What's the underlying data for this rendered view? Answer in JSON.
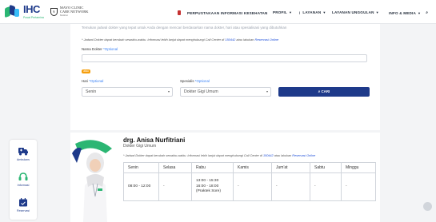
{
  "header": {
    "logo_main": "IHC",
    "logo_sub": "Pusat Pertamina",
    "mayo_l1": "MAYO CLINIC",
    "mayo_l2": "CARE NETWORK",
    "mayo_l3": "Member",
    "nav": [
      {
        "label": "PERPUSTAKAAN INFORMASI KESEHATAN"
      },
      {
        "label": "PROFIL"
      },
      {
        "label": "LAYANAN"
      },
      {
        "label": "LAYANAN UNGGULAN"
      },
      {
        "label": "INFO & MEDIA"
      }
    ]
  },
  "form": {
    "top_notice": "Temukan jadwal dokter yang tepat untuk Anda dengan mencari berdasarkan nama dokter, hari atau spesialisasi yang dibutuhkan",
    "note_prefix": "* Jadwal Dokter dapat berubah sewaktu-waktu. Informasi lebih lanjut dapat menghubungi Call Center di ",
    "note_phone": "150442",
    "note_mid": " atau lakukan ",
    "note_link": "Reservasi Online",
    "nama_label": "Nama Dokter ",
    "nama_opt": "*Optional",
    "nama_value": "",
    "atau": "atau",
    "hari_label": "Hari ",
    "hari_opt": "*Optional",
    "hari_value": "Senin",
    "spesialis_label": "Spesialis ",
    "spesialis_opt": "*Optional",
    "spesialis_value": "Dokter Gigi Umum",
    "cari": "CARI"
  },
  "doctor": {
    "name": "drg. Anisa Nurfitriani",
    "specialty": "Dokter Gigi Umum",
    "note_prefix": "* Jadwal Dokter dapat berubah sewaktu-waktu. Informasi lebih lanjut dapat menghubungi Call Center di ",
    "note_phone": "150442",
    "note_mid": " atau lakukan ",
    "note_link": "Reservasi Online",
    "days": [
      "Senin",
      "Selasa",
      "Rabu",
      "Kamis",
      "Jum'at",
      "Sabtu",
      "Minggu"
    ],
    "schedule": [
      "08:00 - 12:00",
      "-",
      [
        "13:00 - 15:30",
        "16:00 - 18:00",
        "(Praktek Sore)"
      ],
      "-",
      "-",
      "-",
      "-"
    ]
  },
  "side": {
    "ambulans": "Ambulans",
    "informasi": "Informasi",
    "reservasi": "Reservasi"
  },
  "colors": {
    "brand_navy": "#1e3a8a",
    "brand_green": "#2bb673",
    "optional_blue": "#3b82f6",
    "atau_orange": "#f59e0b"
  }
}
